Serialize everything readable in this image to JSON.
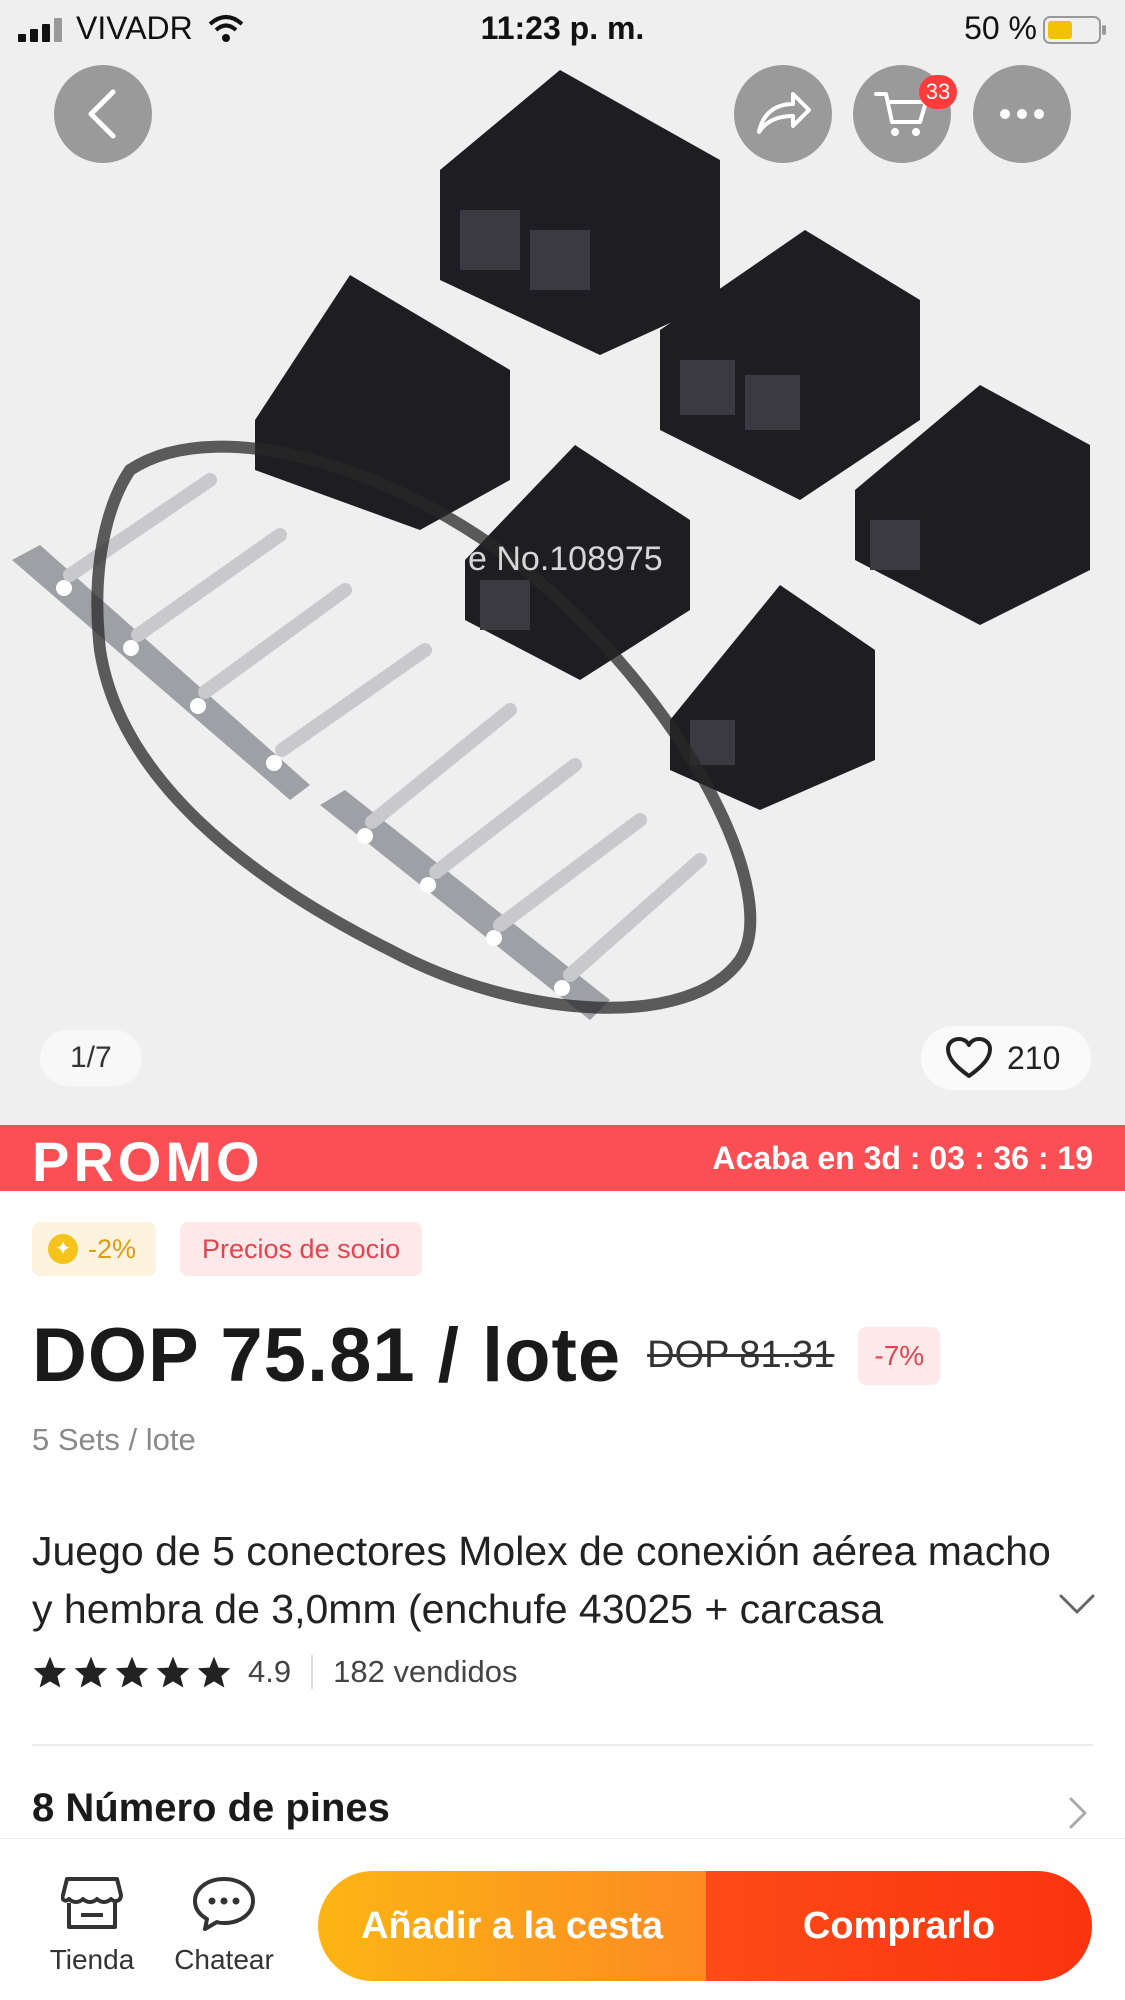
{
  "status_bar": {
    "carrier": "VIVADR",
    "time": "11:23 p. m.",
    "battery_percent": "50 %"
  },
  "gallery": {
    "counter": "1/7",
    "likes": "210",
    "watermark": "e No.108975",
    "cart_badge_count": "33"
  },
  "promo": {
    "label": "PROMO",
    "countdown": "Acaba en 3d : 03 : 36 : 19"
  },
  "badges": {
    "coins_discount": "-2%",
    "member_prices": "Precios de socio"
  },
  "price": {
    "current": "DOP 75.81 / lote",
    "original": "DOP 81.31",
    "discount": "-7%",
    "lot_info": "5 Sets / lote"
  },
  "product": {
    "title": "Juego de 5 conectores Molex de conexión aérea macho y hembra de 3,0mm (enchufe 43025 + carcasa",
    "rating": "4.9",
    "rating_stars": 5,
    "sold": "182 vendidos",
    "pins_option": "8 Número de pines"
  },
  "bottom_bar": {
    "store_label": "Tienda",
    "chat_label": "Chatear",
    "add_to_cart_label": "Añadir a la cesta",
    "buy_now_label": "Comprarlo"
  },
  "colors": {
    "promo_red": "#fb4f55",
    "add_to_cart_orange": "#fd8a22",
    "buy_now_red": "#fb3310",
    "coin_gold": "#f6c31b"
  },
  "icons": [
    "back-arrow-icon",
    "share-icon",
    "cart-icon",
    "more-icon",
    "heart-icon",
    "coin-icon",
    "star-icon",
    "chevron-down-icon",
    "chevron-right-icon",
    "store-icon",
    "chat-icon",
    "signal-icon",
    "wifi-icon",
    "battery-icon"
  ]
}
